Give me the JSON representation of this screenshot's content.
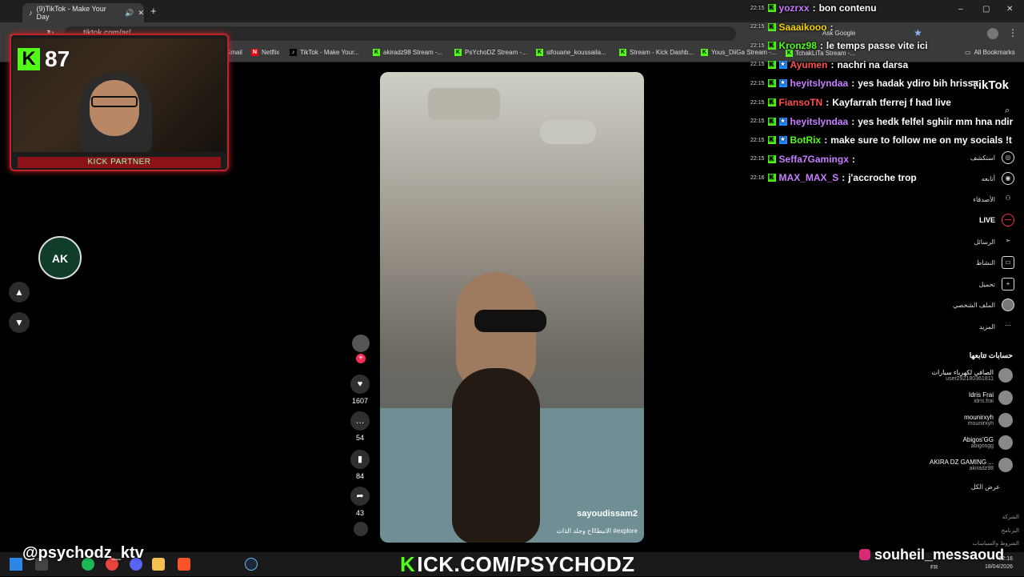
{
  "browser": {
    "tab_title": "(9)TikTok - Make Your Day",
    "url": "tiktok.com/ar/",
    "ask_google": "Ask Google",
    "all_bookmarks": "All Bookmarks",
    "bookmarks": [
      "Gmail",
      "Netflix",
      "TikTok - Make Your...",
      "akiradz98 Stream -...",
      "PsYchoDZ Stream -...",
      "sifouane_koussaila...",
      "Stream - Kick Dashb...",
      "Yous_DiiGa Stream -...",
      "TchakLiTa Stream -..."
    ]
  },
  "stream_overlay": {
    "kick_viewers": "87",
    "partner_label": "KICK PARTNER",
    "logo_text": "AK",
    "handle_left": "@psychodz_ktv",
    "handle_right": "souheil_messaoud",
    "kick_url_k": "K",
    "kick_url_rest": "ICK.COM/PSYCHODZ"
  },
  "video": {
    "username": "sayoudissam2",
    "caption": "الانبطاااح وجلد الذات #explore",
    "likes": "1607",
    "comments": "54",
    "saves": "84",
    "shares": "43"
  },
  "tiktok_sidebar": {
    "logo": "TikTok",
    "nav": [
      {
        "label": "استكشف",
        "icon": "compass-icon"
      },
      {
        "label": "أتابعه",
        "icon": "following-icon"
      },
      {
        "label": "الأصدقاء",
        "icon": "friends-icon"
      },
      {
        "label": "LIVE",
        "icon": "live-icon"
      },
      {
        "label": "الرسائل",
        "icon": "messages-icon"
      },
      {
        "label": "النشاط",
        "icon": "activity-icon"
      },
      {
        "label": "تحميل",
        "icon": "upload-icon"
      },
      {
        "label": "الملف الشخصي",
        "icon": "profile-icon"
      },
      {
        "label": "المزيد",
        "icon": "more-icon"
      }
    ],
    "following_title": "حسابات تتابعها",
    "accounts": [
      {
        "name": "الصافي لكهرباء سيارات",
        "handle": "user292180361811"
      },
      {
        "name": "Idris Frai",
        "handle": "idris.frai"
      },
      {
        "name": "mounirxyh",
        "handle": "mounirxyh"
      },
      {
        "name": "Abigos'GG",
        "handle": "abigosgg"
      },
      {
        "name": "AKIRA DZ GAMING ...",
        "handle": "akiradz98"
      }
    ],
    "see_all": "عرض الكل",
    "footer": [
      "الشركة",
      "البرنامج",
      "الشروط والسياسات"
    ]
  },
  "chat": [
    {
      "time": "22:15",
      "user": "yozrxx",
      "color": "#c77dff",
      "msg": "bon contenu",
      "sub": false
    },
    {
      "time": "22:15",
      "user": "Saaaikooo",
      "color": "#f5d800",
      "msg": "",
      "sub": false
    },
    {
      "time": "22:15",
      "user": "Kronz98",
      "color": "#53fc18",
      "msg": "le temps passe vite ici",
      "sub": false
    },
    {
      "time": "22:15",
      "user": "Ayumen",
      "color": "#ff4f4f",
      "msg": "nachri na darsa",
      "sub": true
    },
    {
      "time": "22:15",
      "user": "heyitslyndaa",
      "color": "#c77dff",
      "msg": "yes hadak ydiro bih hrissa",
      "sub": true
    },
    {
      "time": "22:15",
      "user": "FiansoTN",
      "color": "#ff4f4f",
      "msg": "Kayfarrah tferrej f had live",
      "sub": false
    },
    {
      "time": "22:15",
      "user": "heyitslyndaa",
      "color": "#c77dff",
      "msg": "yes hedk felfel sghiir mm hna ndir",
      "sub": true
    },
    {
      "time": "22:15",
      "user": "BotRix",
      "color": "#53fc18",
      "msg": "make sure to follow me on my socials !t",
      "sub": true
    },
    {
      "time": "22:15",
      "user": "Seffa7Gamingx",
      "color": "#c77dff",
      "msg": "",
      "sub": false
    },
    {
      "time": "22:16",
      "user": "MAX_MAX_S",
      "color": "#c77dff",
      "msg": "j'accroche trop",
      "sub": false
    }
  ],
  "taskbar": {
    "lang": "FR",
    "time": "22:16",
    "date": "18/04/2026"
  },
  "colors": {
    "kick_green": "#53fc18",
    "tiktok_pink": "#fe2c55",
    "partner_red": "#c0222a"
  }
}
